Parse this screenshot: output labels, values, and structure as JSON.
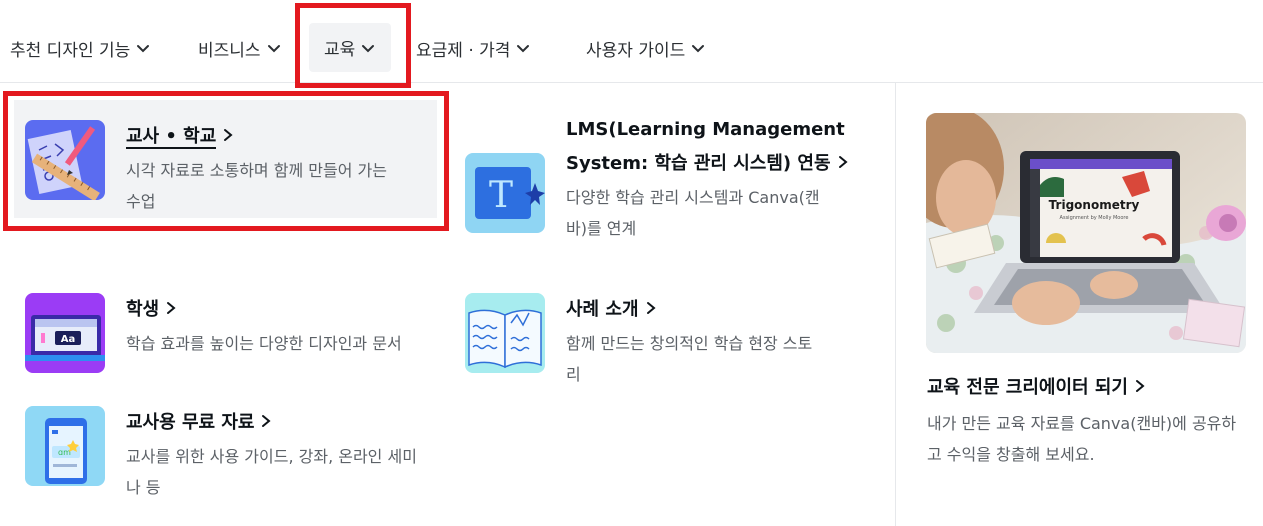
{
  "nav": {
    "items": [
      {
        "label": "추천 디자인 기능"
      },
      {
        "label": "비즈니스"
      },
      {
        "label": "교육"
      },
      {
        "label": "요금제 · 가격"
      },
      {
        "label": "사용자 가이드"
      }
    ]
  },
  "menu": {
    "cards": [
      {
        "title": "교사 • 학교",
        "desc": "시각 자료로 소통하며 함께 만들어 가는 수업",
        "icon": "teacher-school-icon"
      },
      {
        "title": "학생",
        "desc": "학습 효과를 높이는 다양한 디자인과 문서",
        "icon": "student-icon"
      },
      {
        "title": "교사용 무료 자료",
        "desc": "교사를 위한 사용 가이드, 강좌, 온라인 세미나 등",
        "icon": "teacher-resources-icon"
      },
      {
        "title": "LMS(Learning Management System: 학습 관리 시스템) 연동",
        "desc": "다양한 학습 관리 시스템과 Canva(캔바)를 연계",
        "icon": "lms-icon"
      },
      {
        "title": "사례 소개",
        "desc": "함께 만드는 창의적인 학습 현장 스토리",
        "icon": "case-study-icon"
      }
    ],
    "promo": {
      "title": "교육 전문 크리에이터 되기",
      "desc": "내가 만든 교육 자료를 Canva(캔바)에 공유하고 수익을 창출해 보세요.",
      "slide_title": "Trigonometry",
      "slide_subtitle": "Assignment by Molly Moore"
    }
  },
  "colors": {
    "highlight_red": "#e3191f",
    "active_bg": "#f2f3f5",
    "title": "#0e1318",
    "desc": "#5c6167"
  }
}
